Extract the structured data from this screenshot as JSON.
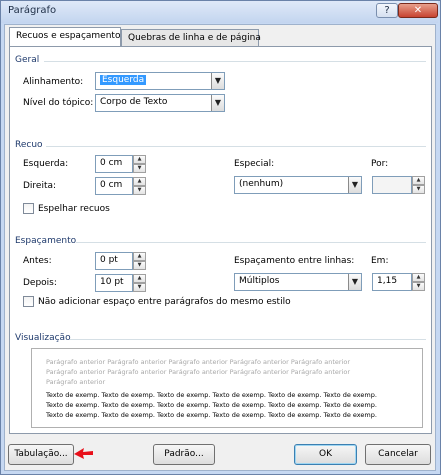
{
  "window": {
    "title": "Parágrafo",
    "help_icon": "?",
    "close_icon": "✕"
  },
  "tabs": [
    {
      "label": "Recuos e espaçamento"
    },
    {
      "label": "Quebras de linha e de página"
    }
  ],
  "geral": {
    "heading": "Geral",
    "alinhamento_label": "Alinhamento:",
    "alinhamento_value": "Esquerda",
    "nivel_label": "Nível do tópico:",
    "nivel_value": "Corpo de Texto"
  },
  "recuo": {
    "heading": "Recuo",
    "esquerda_label": "Esquerda:",
    "esquerda_value": "0 cm",
    "direita_label": "Direita:",
    "direita_value": "0 cm",
    "especial_label": "Especial:",
    "especial_value": "(nenhum)",
    "por_label": "Por:",
    "por_value": "",
    "espelhar_label": "Espelhar recuos"
  },
  "espacamento": {
    "heading": "Espaçamento",
    "antes_label": "Antes:",
    "antes_value": "0 pt",
    "depois_label": "Depois:",
    "depois_value": "10 pt",
    "entre_linhas_label": "Espaçamento entre linhas:",
    "entre_linhas_value": "Múltiplos",
    "em_label": "Em:",
    "em_value": "1,15",
    "nao_adicionar_label": "Não adicionar espaço entre parágrafos do mesmo estilo"
  },
  "visualizacao": {
    "heading": "Visualização",
    "previous_text": "Parágrafo anterior Parágrafo anterior Parágrafo anterior Parágrafo anterior Parágrafo anterior Parágrafo anterior Parágrafo anterior Parágrafo anterior Parágrafo anterior Parágrafo anterior Parágrafo anterior",
    "sample_text": "Texto de exemp. Texto de exemp. Texto de exemp. Texto de exemp. Texto de exemp. Texto de exemp. Texto de exemp. Texto de exemp. Texto de exemp. Texto de exemp. Texto de exemp. Texto de exemp. Texto de exemp. Texto de exemp. Texto de exemp. Texto de exemp. Texto de exemp. Texto de exemp."
  },
  "buttons": {
    "tabulacao": "Tabulação...",
    "padrao": "Padrão...",
    "ok": "OK",
    "cancelar": "Cancelar"
  },
  "colors": {
    "section_heading": "#1f3a6c",
    "selection": "#3399ff",
    "arrow": "#e8101a"
  }
}
